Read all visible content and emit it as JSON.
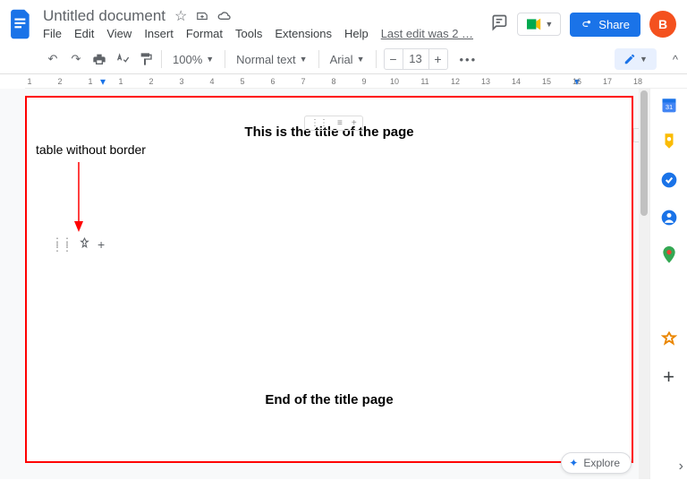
{
  "header": {
    "doc_title": "Untitled document",
    "last_edit": "Last edit was 2 …"
  },
  "menubar": {
    "file": "File",
    "edit": "Edit",
    "view": "View",
    "insert": "Insert",
    "format": "Format",
    "tools": "Tools",
    "extensions": "Extensions",
    "help": "Help"
  },
  "share": {
    "label": "Share"
  },
  "avatar": {
    "initial": "B"
  },
  "toolbar": {
    "zoom": "100%",
    "style": "Normal text",
    "font": "Arial",
    "font_size": "13"
  },
  "ruler": {
    "ticks": [
      "1",
      "2",
      "1",
      "1",
      "2",
      "3",
      "4",
      "5",
      "6",
      "7",
      "8",
      "9",
      "10",
      "11",
      "12",
      "13",
      "14",
      "15",
      "16",
      "17",
      "18"
    ]
  },
  "document": {
    "title_text": "This is the title of the page",
    "end_text": "End of the title page",
    "annotation": "table without border"
  },
  "explore": {
    "label": "Explore"
  }
}
